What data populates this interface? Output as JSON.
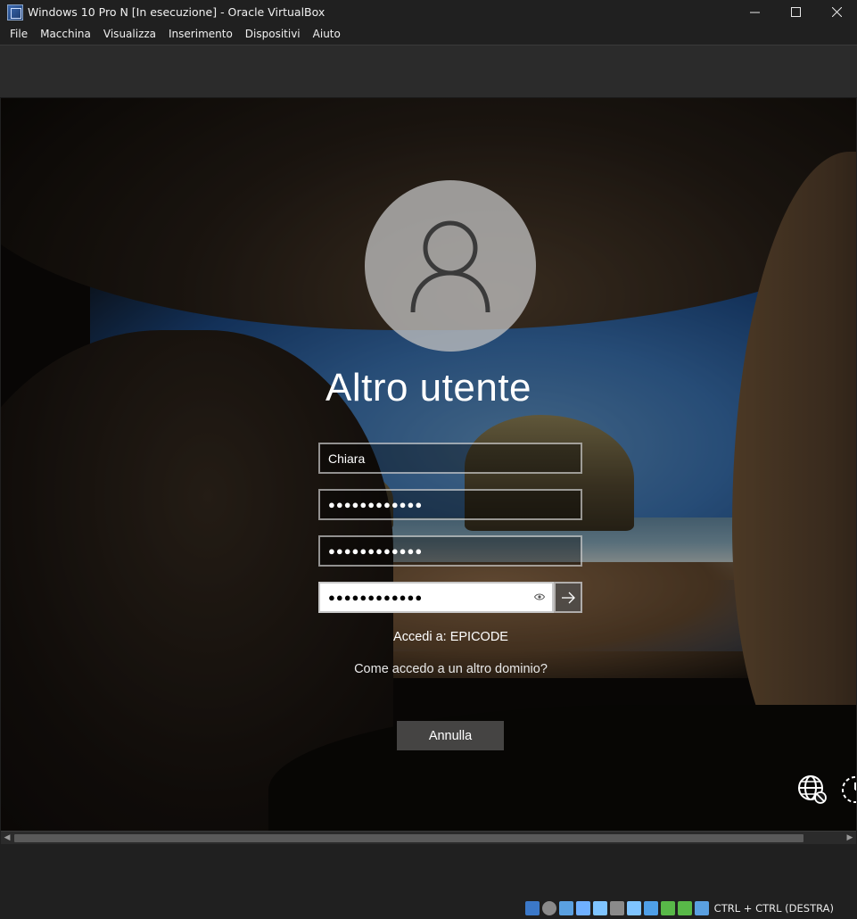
{
  "window": {
    "title": "Windows 10 Pro N [In esecuzione] - Oracle VirtualBox",
    "minimize": "—",
    "maximize": "☐",
    "close": "✕"
  },
  "menu": {
    "items": [
      "File",
      "Macchina",
      "Visualizza",
      "Inserimento",
      "Dispositivi",
      "Aiuto"
    ]
  },
  "login": {
    "heading": "Altro utente",
    "username_value": "Chiara",
    "password1_value": "●●●●●●●●●●●●",
    "password2_value": "●●●●●●●●●●●●",
    "password3_value": "●●●●●●●●●●●●",
    "sign_in_to": "Accedi a: EPICODE",
    "other_domain_link": "Come accedo a un altro dominio?",
    "cancel_label": "Annulla"
  },
  "statusbar": {
    "host_key": "CTRL + CTRL (DESTRA)",
    "icons": [
      "hard-disk-icon",
      "optical-drive-icon",
      "audio-icon",
      "network-icon",
      "usb-icon",
      "shared-folders-icon",
      "display-icon",
      "video-capture-icon",
      "cpu-icon",
      "mouse-integration-icon",
      "keyboard-icon"
    ],
    "icon_colors": [
      "#3b78c8",
      "#8a8a8a",
      "#5aa0e0",
      "#6fb0ff",
      "#7fc4ff",
      "#8a8a8a",
      "#7fc4ff",
      "#4fa0e8",
      "#58b848",
      "#58b848",
      "#5aa0e0"
    ]
  }
}
